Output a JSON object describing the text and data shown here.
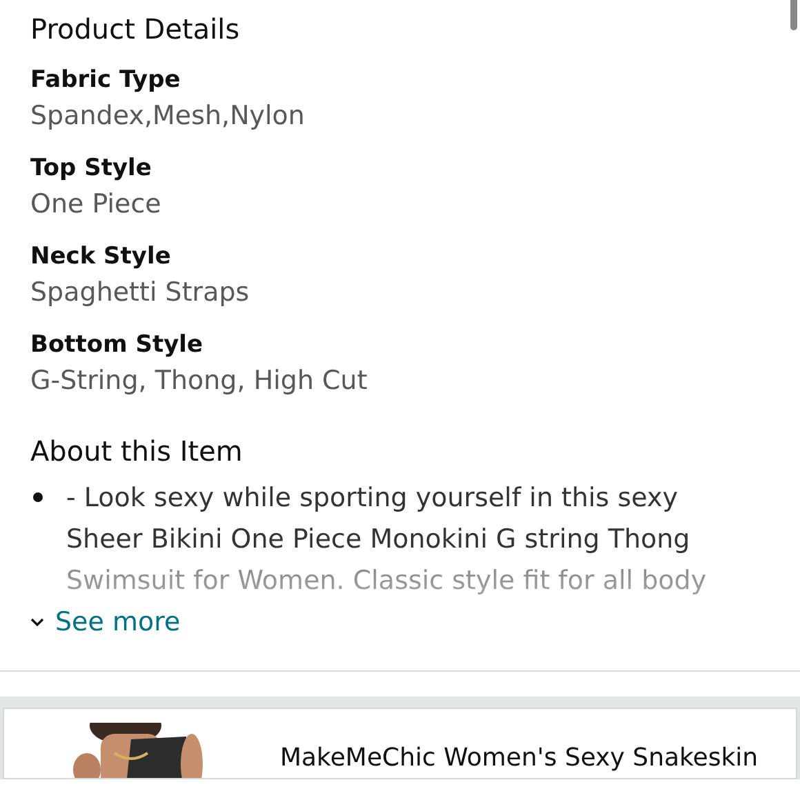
{
  "product_details": {
    "title": "Product Details",
    "attributes": [
      {
        "label": "Fabric Type",
        "value": "Spandex,Mesh,Nylon"
      },
      {
        "label": "Top Style",
        "value": "One Piece"
      },
      {
        "label": "Neck Style",
        "value": "Spaghetti Straps"
      },
      {
        "label": "Bottom Style",
        "value": "G-String, Thong, High Cut"
      }
    ]
  },
  "about": {
    "title": "About this Item",
    "bullets": [
      "- Look sexy while sporting yourself in this sexy Sheer Bikini One Piece Monokini G string Thong Swimsuit for Women. Classic style fit for all body"
    ],
    "expanded": false,
    "toggle": "See more"
  },
  "product_card": {
    "title": "MakeMeChic Women's Sexy Snakeskin"
  }
}
